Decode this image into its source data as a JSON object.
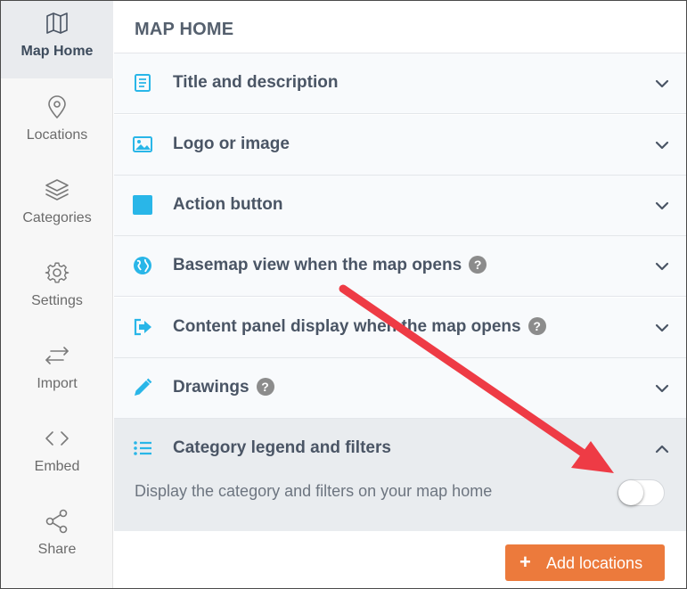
{
  "sidebar": {
    "items": [
      {
        "label": "Map Home",
        "icon": "map-icon",
        "active": true
      },
      {
        "label": "Locations",
        "icon": "location-pin-icon"
      },
      {
        "label": "Categories",
        "icon": "layers-icon"
      },
      {
        "label": "Settings",
        "icon": "gear-icon"
      },
      {
        "label": "Import",
        "icon": "arrows-left-right-icon"
      },
      {
        "label": "Embed",
        "icon": "code-icon"
      },
      {
        "label": "Share",
        "icon": "share-icon"
      }
    ]
  },
  "main": {
    "title": "MAP HOME",
    "sections": [
      {
        "label": "Title and description",
        "icon": "document-icon"
      },
      {
        "label": "Logo or image",
        "icon": "image-icon"
      },
      {
        "label": "Action button",
        "icon": "square-icon"
      },
      {
        "label": "Basemap view when the map opens",
        "icon": "globe-icon",
        "help": "?"
      },
      {
        "label": "Content panel display when the map opens",
        "icon": "panel-enter-icon",
        "help": "?"
      },
      {
        "label": "Drawings",
        "icon": "pencil-icon",
        "help": "?"
      },
      {
        "label": "Category legend and filters",
        "icon": "list-icon",
        "expanded": true,
        "description": "Display the category and filters on your map home",
        "toggle_on": false
      }
    ],
    "add_button": {
      "label": "Add locations",
      "icon": "plus-icon"
    }
  },
  "colors": {
    "accent_icon": "#29b6e8",
    "button": "#ec7a3c",
    "annotation_arrow": "#ee3b45"
  }
}
